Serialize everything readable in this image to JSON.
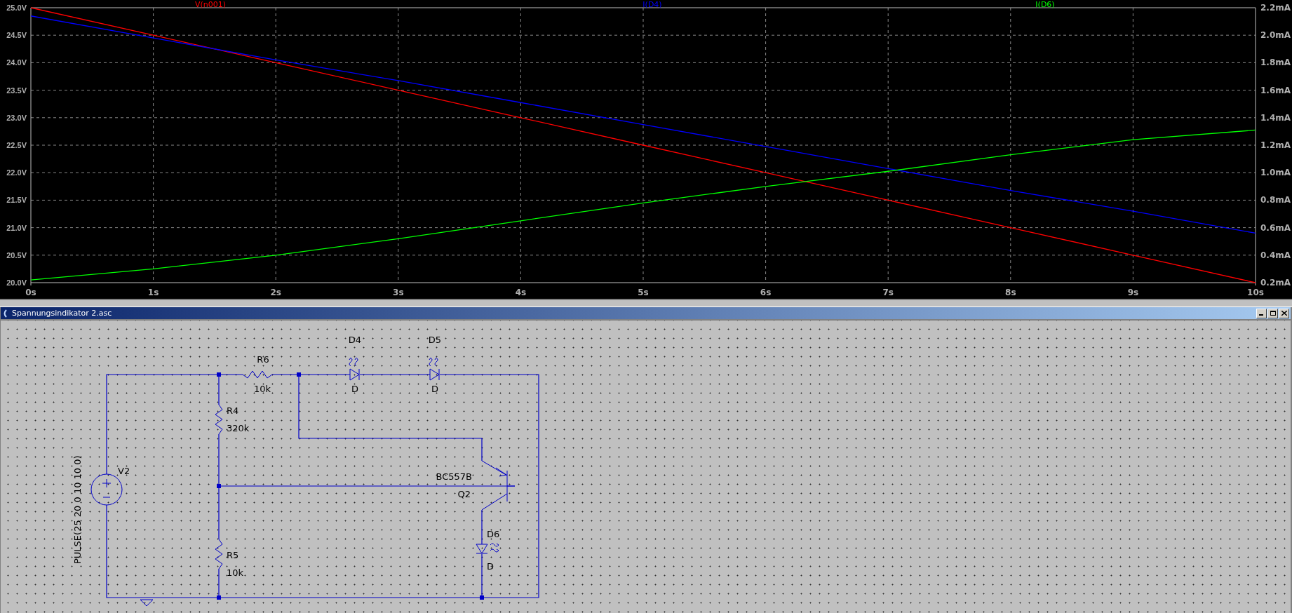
{
  "chart_data": {
    "type": "line",
    "x": [
      0,
      1,
      2,
      3,
      4,
      5,
      6,
      7,
      8,
      9,
      10
    ],
    "xticks": [
      {
        "value": 0,
        "label": "0s"
      },
      {
        "value": 1,
        "label": "1s"
      },
      {
        "value": 2,
        "label": "2s"
      },
      {
        "value": 3,
        "label": "3s"
      },
      {
        "value": 4,
        "label": "4s"
      },
      {
        "value": 5,
        "label": "5s"
      },
      {
        "value": 6,
        "label": "6s"
      },
      {
        "value": 7,
        "label": "7s"
      },
      {
        "value": 8,
        "label": "8s"
      },
      {
        "value": 9,
        "label": "9s"
      },
      {
        "value": 10,
        "label": "10s"
      }
    ],
    "yticks": [
      {
        "value": 20.0,
        "label": "20.0V"
      },
      {
        "value": 20.5,
        "label": "20.5V"
      },
      {
        "value": 21.0,
        "label": "21.0V"
      },
      {
        "value": 21.5,
        "label": "21.5V"
      },
      {
        "value": 22.0,
        "label": "22.0V"
      },
      {
        "value": 22.5,
        "label": "22.5V"
      },
      {
        "value": 23.0,
        "label": "23.0V"
      },
      {
        "value": 23.5,
        "label": "23.5V"
      },
      {
        "value": 24.0,
        "label": "24.0V"
      },
      {
        "value": 24.5,
        "label": "24.5V"
      },
      {
        "value": 25.0,
        "label": "25.0V"
      }
    ],
    "y2ticks": [
      {
        "value": 0.2,
        "label": "0.2mA"
      },
      {
        "value": 0.4,
        "label": "0.4mA"
      },
      {
        "value": 0.6,
        "label": "0.6mA"
      },
      {
        "value": 0.8,
        "label": "0.8mA"
      },
      {
        "value": 1.0,
        "label": "1.0mA"
      },
      {
        "value": 1.2,
        "label": "1.2mA"
      },
      {
        "value": 1.4,
        "label": "1.4mA"
      },
      {
        "value": 1.6,
        "label": "1.6mA"
      },
      {
        "value": 1.8,
        "label": "1.8mA"
      },
      {
        "value": 2.0,
        "label": "2.0mA"
      },
      {
        "value": 2.2,
        "label": "2.2mA"
      }
    ],
    "grid": true,
    "xlim": [
      0,
      10
    ],
    "ylim": [
      20,
      25
    ],
    "y2lim": [
      0.2,
      2.2
    ],
    "series": [
      {
        "name": "V(n001)",
        "color": "#ff0000",
        "values": [
          25,
          24.5,
          24,
          23.5,
          23,
          22.5,
          22,
          21.5,
          21,
          20.5,
          20
        ]
      },
      {
        "name": "I(D4)",
        "color": "#0000ff",
        "axis": "y2",
        "values": [
          2.14,
          1.98,
          1.82,
          1.67,
          1.51,
          1.35,
          1.19,
          1.03,
          0.87,
          0.72,
          0.56
        ]
      },
      {
        "name": "I(D6)",
        "color": "#00ff00",
        "axis": "y2",
        "values": [
          0.22,
          0.3,
          0.4,
          0.52,
          0.65,
          0.78,
          0.9,
          1.01,
          1.13,
          1.24,
          1.31
        ]
      }
    ]
  },
  "schematic_window": {
    "title": "Spannungsindikator 2.asc",
    "components": [
      {
        "kind": "source",
        "name": "V2",
        "value": "PULSE(25 20 0 10 10 0)"
      },
      {
        "kind": "resistor",
        "name": "R6",
        "value": "10k"
      },
      {
        "kind": "resistor",
        "name": "R4",
        "value": "320k"
      },
      {
        "kind": "resistor",
        "name": "R5",
        "value": "10k"
      },
      {
        "kind": "led",
        "name": "D4",
        "value": "D"
      },
      {
        "kind": "led",
        "name": "D5",
        "value": "D"
      },
      {
        "kind": "transistor",
        "name": "Q2",
        "value": "BC557B"
      },
      {
        "kind": "led",
        "name": "D6",
        "value": "D"
      }
    ]
  }
}
